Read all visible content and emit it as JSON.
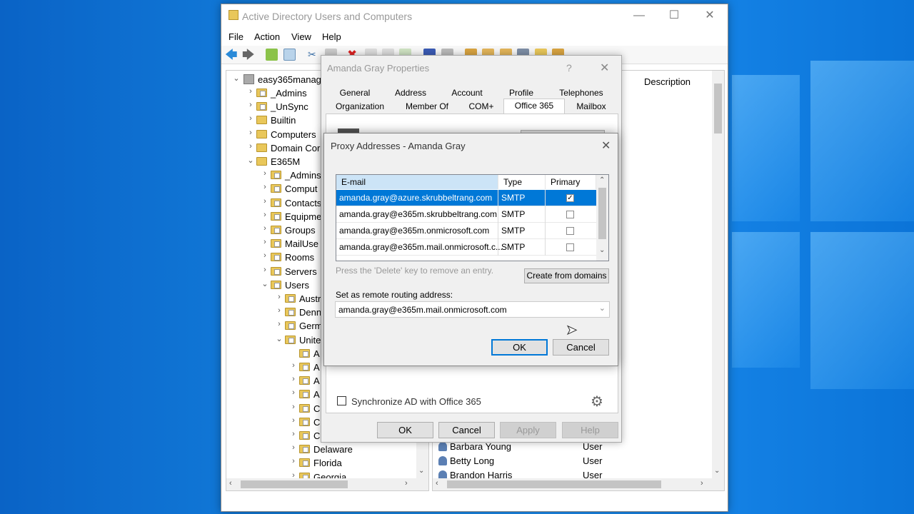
{
  "window": {
    "title": "Active Directory Users and Computers"
  },
  "menu": [
    "File",
    "Action",
    "View",
    "Help"
  ],
  "tree": {
    "root": "easy365manage",
    "items": [
      "_Admins",
      "_UnSync",
      "Builtin",
      "Computers",
      "Domain Cor",
      "E365M",
      "_Admins",
      "Comput",
      "Contacts",
      "Equipme",
      "Groups",
      "MailUse",
      "Rooms",
      "Servers",
      "Users",
      "Austr",
      "Denn",
      "Germ",
      "Unite",
      "A",
      "A",
      "A",
      "A",
      "C",
      "C",
      "C",
      "Delaware",
      "Florida",
      "Georgia"
    ]
  },
  "list": {
    "header_description": "Description",
    "rows": [
      {
        "name": "Barbara Young",
        "type": "User"
      },
      {
        "name": "Betty Long",
        "type": "User"
      },
      {
        "name": "Brandon Harris",
        "type": "User"
      }
    ]
  },
  "props": {
    "title": "Amanda Gray Properties",
    "help": "?",
    "tabs_row1": [
      "General",
      "Address",
      "Account",
      "Profile",
      "Telephones"
    ],
    "tabs_row2": [
      "Organization",
      "Member Of",
      "COM+",
      "Office 365",
      "Mailbox"
    ],
    "selected_tab": "Office 365",
    "sync_label": "Synchronize AD with Office 365",
    "buttons": {
      "ok": "OK",
      "cancel": "Cancel",
      "apply": "Apply",
      "help": "Help"
    }
  },
  "proxy": {
    "title": "Proxy Addresses - Amanda Gray",
    "columns": [
      "E-mail",
      "Type",
      "Primary"
    ],
    "rows": [
      {
        "email": "amanda.gray@azure.skrubbeltrang.com",
        "type": "SMTP",
        "primary": true
      },
      {
        "email": "amanda.gray@e365m.skrubbeltrang.com",
        "type": "SMTP",
        "primary": false
      },
      {
        "email": "amanda.gray@e365m.onmicrosoft.com",
        "type": "SMTP",
        "primary": false
      },
      {
        "email": "amanda.gray@e365m.mail.onmicrosoft.c...",
        "type": "SMTP",
        "primary": false
      }
    ],
    "hint": "Press the 'Delete' key to remove an entry.",
    "create_button": "Create from domains",
    "routing_label": "Set as remote routing address:",
    "routing_value": "amanda.gray@e365m.mail.onmicrosoft.com",
    "ok": "OK",
    "cancel": "Cancel"
  }
}
